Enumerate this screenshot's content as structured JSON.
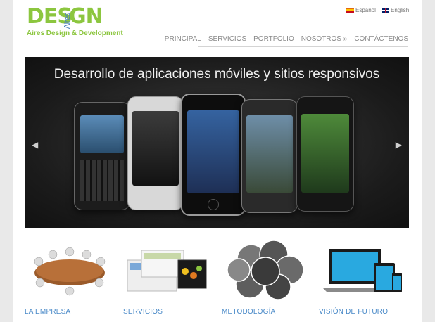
{
  "logo": {
    "text_left": "DES",
    "text_mid": "Aires",
    "text_right": "GN",
    "subtitle": "Aires Design & Development"
  },
  "languages": {
    "es": "Español",
    "en": "English"
  },
  "nav": [
    "PRINCIPAL",
    "SERVICIOS",
    "PORTFOLIO",
    "NOSOTROS »",
    "CONTÁCTENOS"
  ],
  "slider": {
    "caption": "Desarrollo de aplicaciones móviles y sitios responsivos",
    "prev": "◀",
    "next": "▶"
  },
  "features": [
    {
      "title": "LA EMPRESA"
    },
    {
      "title": "SERVICIOS"
    },
    {
      "title": "METODOLOGÍA"
    },
    {
      "title": "VISIÓN DE FUTURO"
    }
  ],
  "colors": {
    "brand_green": "#8cc63f",
    "link_blue": "#4a8ac8",
    "nav_gray": "#8a8a8a"
  }
}
